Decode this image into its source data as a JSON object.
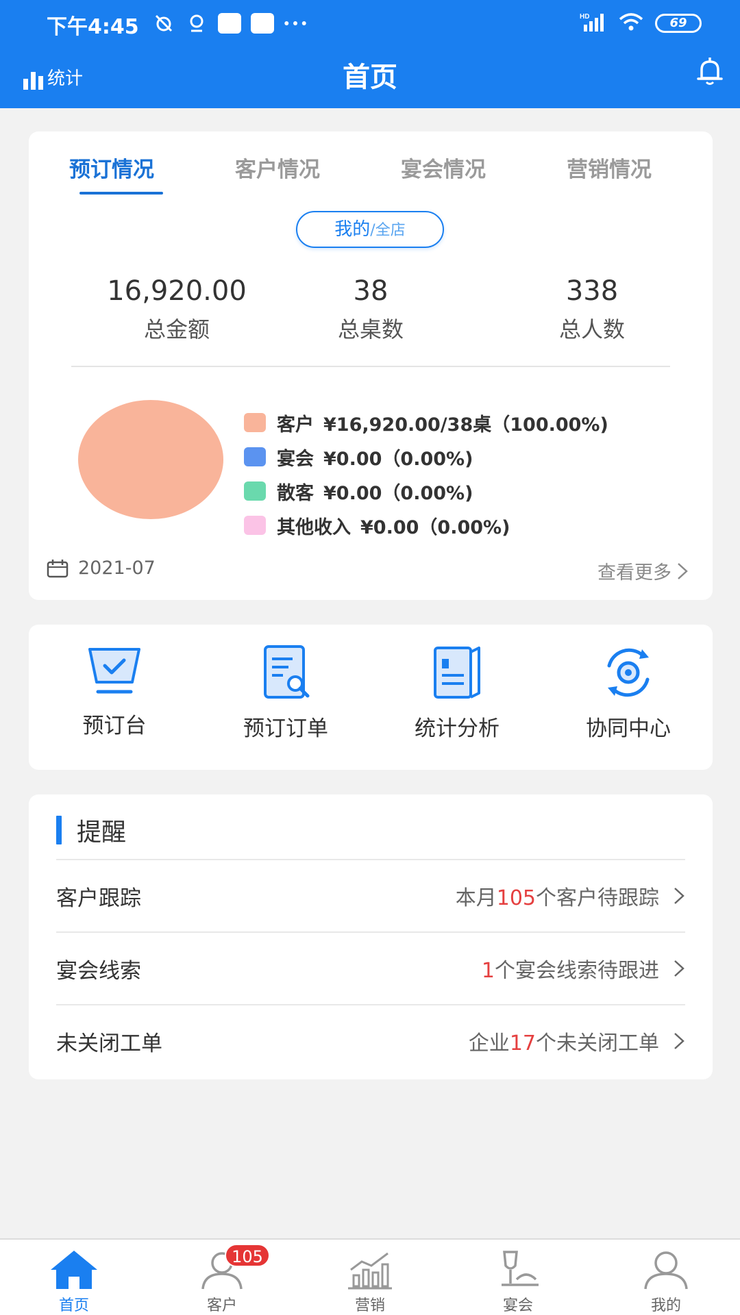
{
  "status_bar": {
    "time": "下午4:45",
    "battery": "69",
    "network": "HD"
  },
  "header": {
    "left_label": "统计",
    "title": "首页"
  },
  "tabs": [
    {
      "label": "预订情况",
      "active": true
    },
    {
      "label": "客户情况",
      "active": false
    },
    {
      "label": "宴会情况",
      "active": false
    },
    {
      "label": "营销情况",
      "active": false
    }
  ],
  "scope": {
    "mine": "我的",
    "separator_all": "/全店"
  },
  "metrics": [
    {
      "value": "16,920.00",
      "label": "总金额"
    },
    {
      "value": "38",
      "label": "总桌数"
    },
    {
      "value": "338",
      "label": "总人数"
    }
  ],
  "chart_data": {
    "type": "pie",
    "slices": [
      {
        "name": "客户",
        "text": "¥16,920.00/38桌（100.00%)",
        "value": 100.0,
        "color": "#f9b49a"
      },
      {
        "name": "宴会",
        "text": "¥0.00（0.00%)",
        "value": 0.0,
        "color": "#5b93f0"
      },
      {
        "name": "散客",
        "text": "¥0.00（0.00%)",
        "value": 0.0,
        "color": "#6ad9ad"
      },
      {
        "name": "其他收入",
        "text": "¥0.00（0.00%)",
        "value": 0.0,
        "color": "#fbc3e6"
      }
    ]
  },
  "period": {
    "date": "2021-07",
    "more_label": "查看更多"
  },
  "shortcuts": [
    {
      "label": "预订台",
      "icon": "monitor-check-icon"
    },
    {
      "label": "预订订单",
      "icon": "document-search-icon"
    },
    {
      "label": "统计分析",
      "icon": "report-book-icon"
    },
    {
      "label": "协同中心",
      "icon": "sync-gear-icon"
    }
  ],
  "reminders": {
    "title": "提醒",
    "items": [
      {
        "label": "客户跟踪",
        "prefix": "本月",
        "count": "105",
        "suffix": "个客户待跟踪"
      },
      {
        "label": "宴会线索",
        "prefix": "",
        "count": "1",
        "suffix": "个宴会线索待跟进"
      },
      {
        "label": "未关闭工单",
        "prefix": "企业",
        "count": "17",
        "suffix": "个未关闭工单"
      }
    ]
  },
  "bottom_nav": [
    {
      "label": "首页",
      "icon": "home-icon",
      "active": true
    },
    {
      "label": "客户",
      "icon": "user-icon",
      "badge": "105"
    },
    {
      "label": "营销",
      "icon": "chart-trend-icon"
    },
    {
      "label": "宴会",
      "icon": "banquet-icon"
    },
    {
      "label": "我的",
      "icon": "profile-icon"
    }
  ],
  "colors": {
    "primary": "#1a7ff0",
    "highlight": "#e54040"
  }
}
